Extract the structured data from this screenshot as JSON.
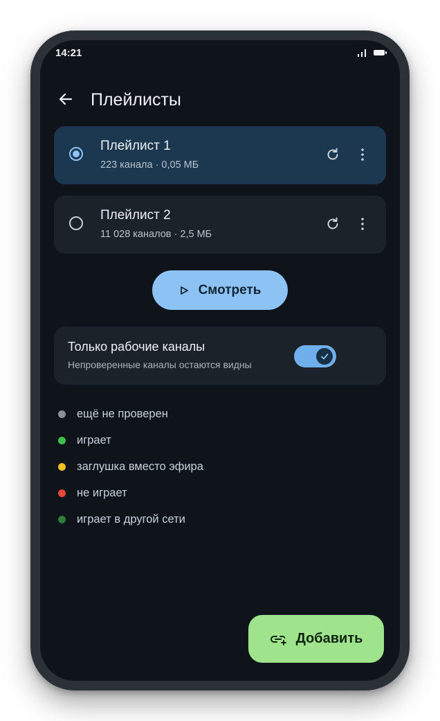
{
  "status_bar": {
    "time": "14:21"
  },
  "header": {
    "title": "Плейлисты"
  },
  "playlists": [
    {
      "title": "Плейлист 1",
      "subtitle": "223 канала · 0,05 МБ",
      "selected": true
    },
    {
      "title": "Плейлист 2",
      "subtitle": "11 028 каналов · 2,5 МБ",
      "selected": false
    }
  ],
  "watch_button": {
    "label": "Смотреть"
  },
  "filter": {
    "title": "Только рабочие каналы",
    "subtitle": "Непроверенные каналы остаются видны",
    "enabled": true
  },
  "legend": [
    {
      "label": "ещё не проверен",
      "color": "#8a9099"
    },
    {
      "label": "играет",
      "color": "#3fbf4a"
    },
    {
      "label": "заглушка вместо эфира",
      "color": "#f5c020"
    },
    {
      "label": "не играет",
      "color": "#e8473c"
    },
    {
      "label": "играет в другой сети",
      "color": "#2e7d3a"
    }
  ],
  "add_button": {
    "label": "Добавить"
  },
  "colors": {
    "background": "#0f141b",
    "accent_blue": "#8cc3f4",
    "accent_green": "#9fe38c"
  }
}
